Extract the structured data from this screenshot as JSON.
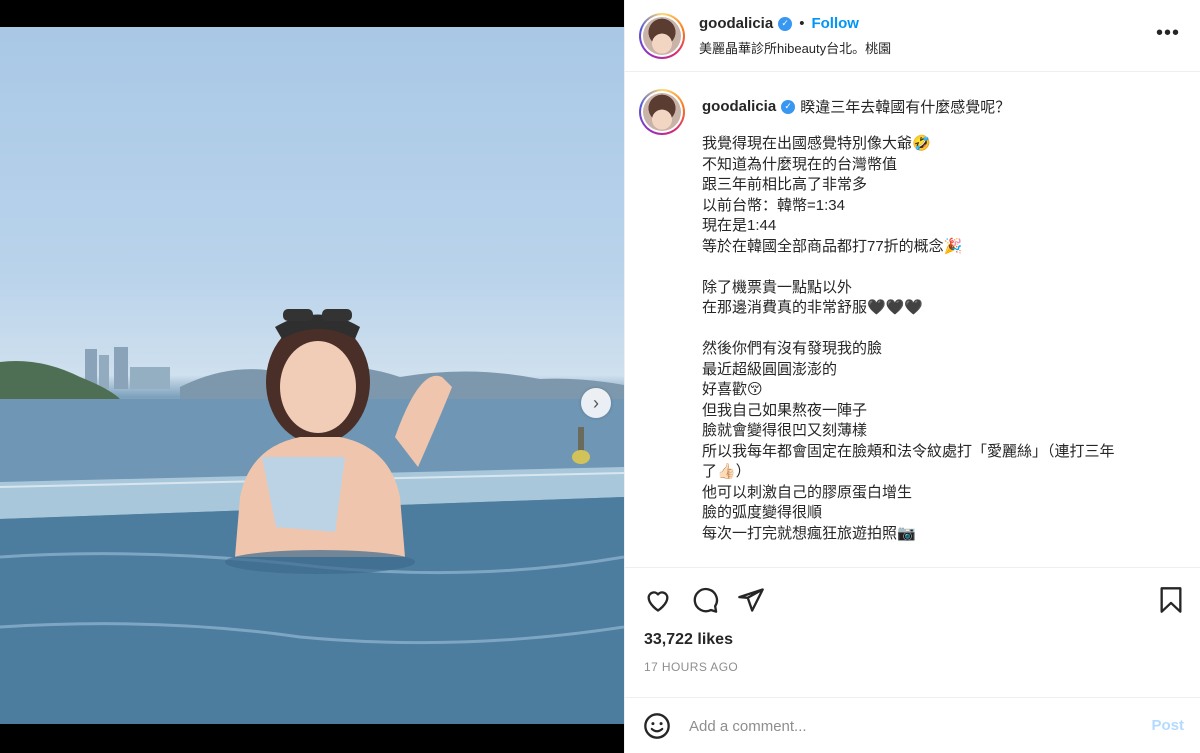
{
  "post": {
    "username": "goodalicia",
    "follow_label": "Follow",
    "separator": "•",
    "location": "美麗晶華診所hibeauty台北。桃園",
    "more_label": "•••",
    "verified_glyph": "✓",
    "next_arrow": "›"
  },
  "caption": {
    "username": "goodalicia",
    "first_line": "睽違三年去韓國有什麼感覺呢？",
    "body": "我覺得現在出國感覺特別像大爺🤣\n不知道為什麼現在的台灣幣值\n跟三年前相比高了非常多\n以前台幣：韓幣=1:34\n現在是1:44\n等於在韓國全部商品都打77折的概念🎉\n\n除了機票貴一點點以外\n在那邊消費真的非常舒服🖤🖤🖤\n\n然後你們有沒有發現我的臉\n最近超級圓圓澎澎的\n好喜歡😚\n但我自己如果熬夜一陣子\n臉就會變得很凹又刻薄樣\n所以我每年都會固定在臉頰和法令紋處打「愛麗絲」（連打三年\n了👍🏻）\n他可以刺激自己的膠原蛋白增生\n臉的弧度變得很順\n每次一打完就想瘋狂旅遊拍照📷"
  },
  "stats": {
    "likes": "33,722 likes",
    "time": "17 HOURS AGO"
  },
  "comment": {
    "placeholder": "Add a comment...",
    "post_label": "Post"
  },
  "carousel": {
    "dots": 3,
    "active_index": 0
  },
  "icons": [
    "heart-icon",
    "comment-icon",
    "share-icon",
    "bookmark-icon",
    "emoji-icon",
    "verified-icon",
    "more-icon",
    "chevron-right-icon"
  ],
  "colors": {
    "accent": "#0095f6",
    "verified": "#3897f0",
    "post_disabled": "#b3dbff",
    "muted": "#8e8e8e"
  }
}
